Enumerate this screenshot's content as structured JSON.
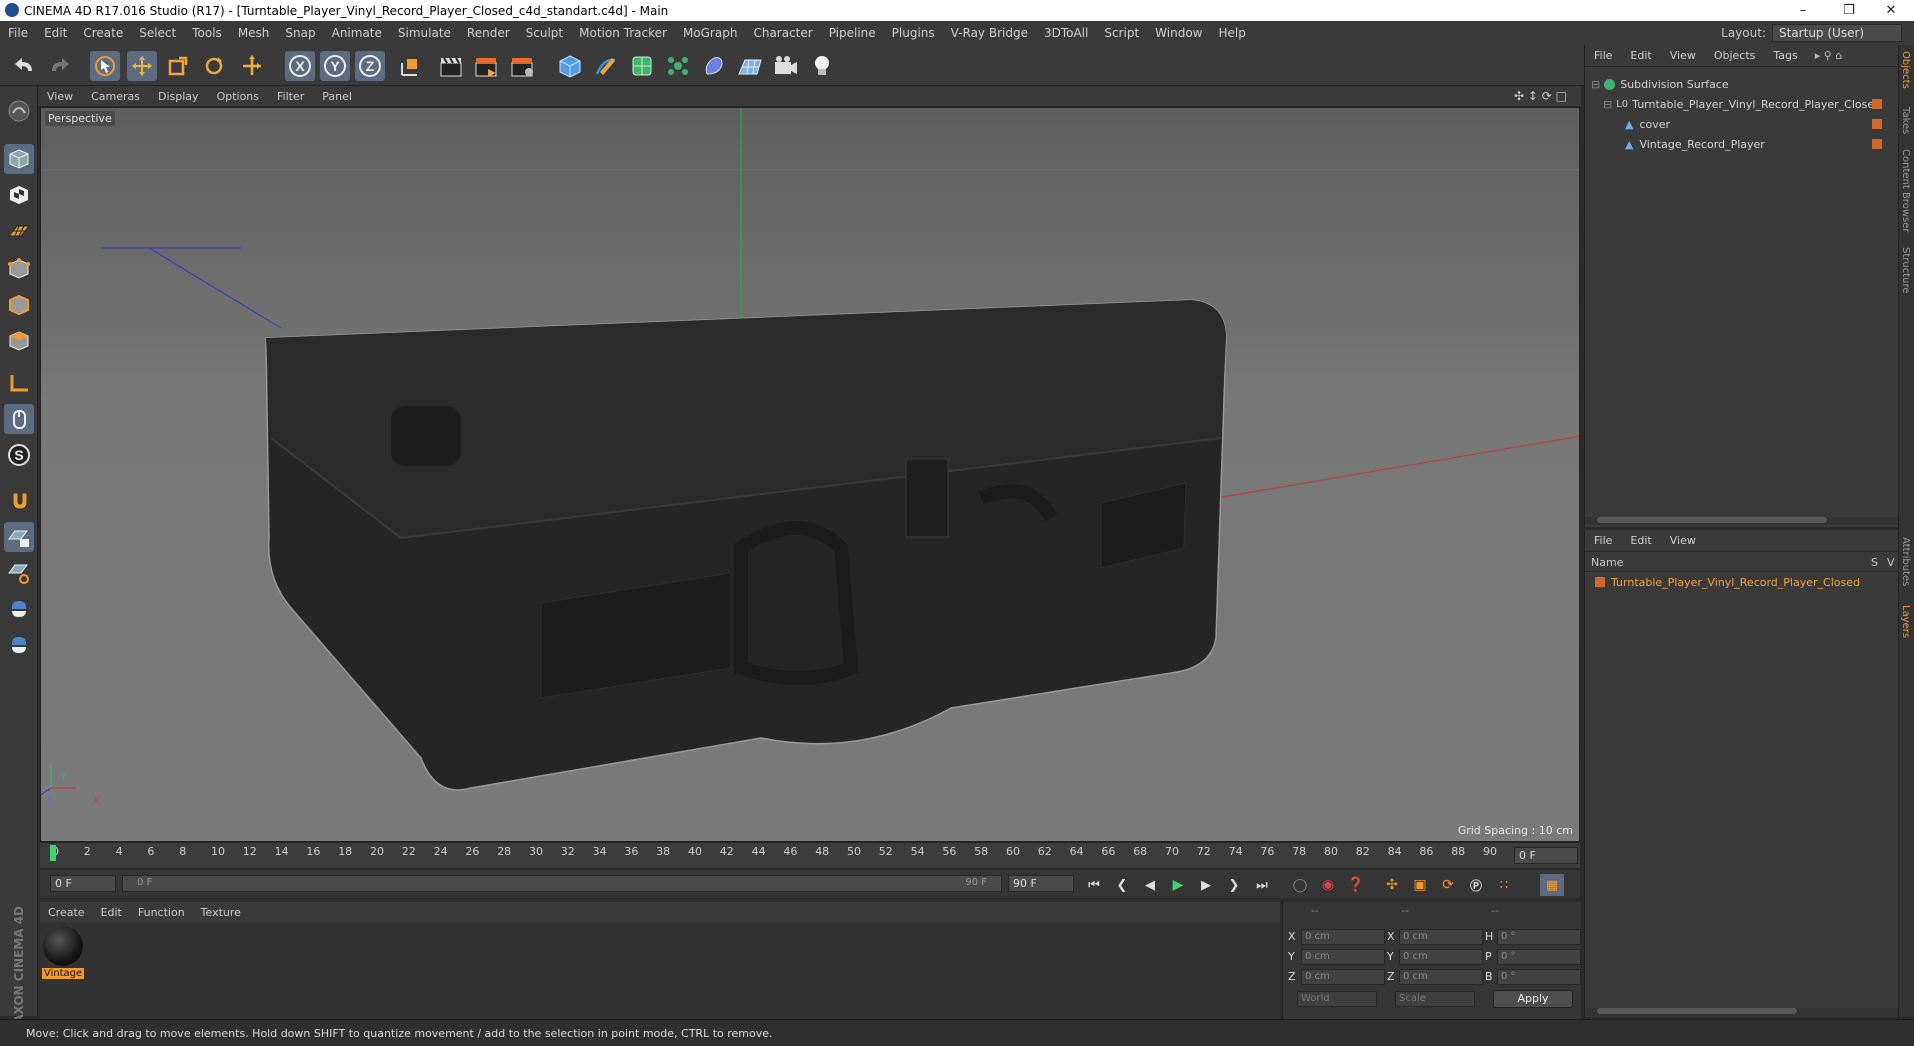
{
  "window": {
    "title": "CINEMA 4D R17.016 Studio (R17) - [Turntable_Player_Vinyl_Record_Player_Closed_c4d_standart.c4d] - Main"
  },
  "menubar": {
    "items": [
      "File",
      "Edit",
      "Create",
      "Select",
      "Tools",
      "Mesh",
      "Snap",
      "Animate",
      "Simulate",
      "Render",
      "Sculpt",
      "Motion Tracker",
      "MoGraph",
      "Character",
      "Pipeline",
      "Plugins",
      "V-Ray Bridge",
      "3DToAll",
      "Script",
      "Window",
      "Help"
    ],
    "layout_label": "Layout:",
    "layout_value": "Startup (User)"
  },
  "viewport": {
    "menu": [
      "View",
      "Cameras",
      "Display",
      "Options",
      "Filter",
      "Panel"
    ],
    "camera_label": "Perspective",
    "grid_spacing": "Grid Spacing : 10 cm"
  },
  "timeline": {
    "ticks": [
      "0",
      "2",
      "4",
      "6",
      "8",
      "10",
      "12",
      "14",
      "16",
      "18",
      "20",
      "22",
      "24",
      "26",
      "28",
      "30",
      "32",
      "34",
      "36",
      "38",
      "40",
      "42",
      "44",
      "46",
      "48",
      "50",
      "52",
      "54",
      "56",
      "58",
      "60",
      "62",
      "64",
      "66",
      "68",
      "70",
      "72",
      "74",
      "76",
      "78",
      "80",
      "82",
      "84",
      "86",
      "88",
      "90"
    ],
    "current_frame": "0 F",
    "start_field": "0 F",
    "range_start": "0 F",
    "range_end": "90 F",
    "end_field": "90 F"
  },
  "material_manager": {
    "menu": [
      "Create",
      "Edit",
      "Function",
      "Texture"
    ],
    "materials": [
      {
        "name": "Vintage"
      }
    ]
  },
  "coordinates": {
    "header": [
      "--",
      "--",
      "--"
    ],
    "rows": [
      {
        "axis": "X",
        "pos": "0 cm",
        "axis2": "X",
        "size": "0 cm",
        "rot_axis": "H",
        "rot": "0 °"
      },
      {
        "axis": "Y",
        "pos": "0 cm",
        "axis2": "Y",
        "size": "0 cm",
        "rot_axis": "P",
        "rot": "0 °"
      },
      {
        "axis": "Z",
        "pos": "0 cm",
        "axis2": "Z",
        "size": "0 cm",
        "rot_axis": "B",
        "rot": "0 °"
      }
    ],
    "mode": "World",
    "scale_mode": "Scale",
    "apply_label": "Apply"
  },
  "object_manager": {
    "menu": [
      "File",
      "Edit",
      "View",
      "Objects",
      "Tags"
    ],
    "objects": [
      {
        "name": "Subdivision Surface"
      },
      {
        "name": "Turntable_Player_Vinyl_Record_Player_Closed"
      },
      {
        "name": "cover"
      },
      {
        "name": "Vintage_Record_Player"
      }
    ]
  },
  "layer_manager": {
    "menu": [
      "File",
      "Edit",
      "View"
    ],
    "col_name": "Name",
    "col_s": "S",
    "col_v": "V",
    "layers": [
      {
        "name": "Turntable_Player_Vinyl_Record_Player_Closed"
      }
    ]
  },
  "right_tabs": [
    "Objects",
    "Takes",
    "Content Browser",
    "Structure",
    "Attributes",
    "Layers"
  ],
  "status": {
    "text": "Move: Click and drag to move elements. Hold down SHIFT to quantize movement / add to the selection in point mode, CTRL to remove."
  },
  "brand": {
    "text": "MAXON CINEMA 4D"
  },
  "colors": {
    "accent": "#d4682a",
    "selected_tool": "#5b6c80",
    "timeline_marker": "#3fd36b"
  }
}
